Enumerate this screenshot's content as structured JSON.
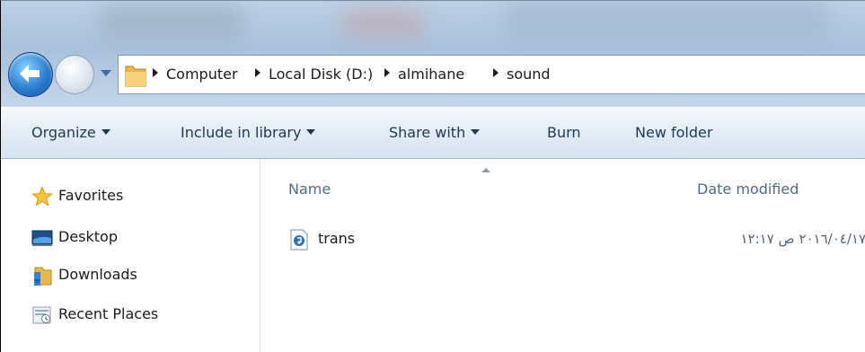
{
  "address": {
    "crumbs": [
      "Computer",
      "Local Disk (D:)",
      "almihane",
      "sound"
    ]
  },
  "toolbar": {
    "organize": "Organize",
    "include_in_library": "Include in library",
    "share_with": "Share with",
    "burn": "Burn",
    "new_folder": "New folder"
  },
  "nav": {
    "favorites": "Favorites",
    "items": [
      "Desktop",
      "Downloads",
      "Recent Places"
    ]
  },
  "columns": {
    "name": "Name",
    "date_modified": "Date modified"
  },
  "files": [
    {
      "name": "trans",
      "date_modified": "٢٠١٦/٠٤/١٧ ص ١٢:١٧",
      "icon": "audio-file-icon"
    }
  ],
  "colors": {
    "accent": "#2a7ed1",
    "toolbar_text": "#1e3957",
    "column_header": "#4e6b8a"
  }
}
